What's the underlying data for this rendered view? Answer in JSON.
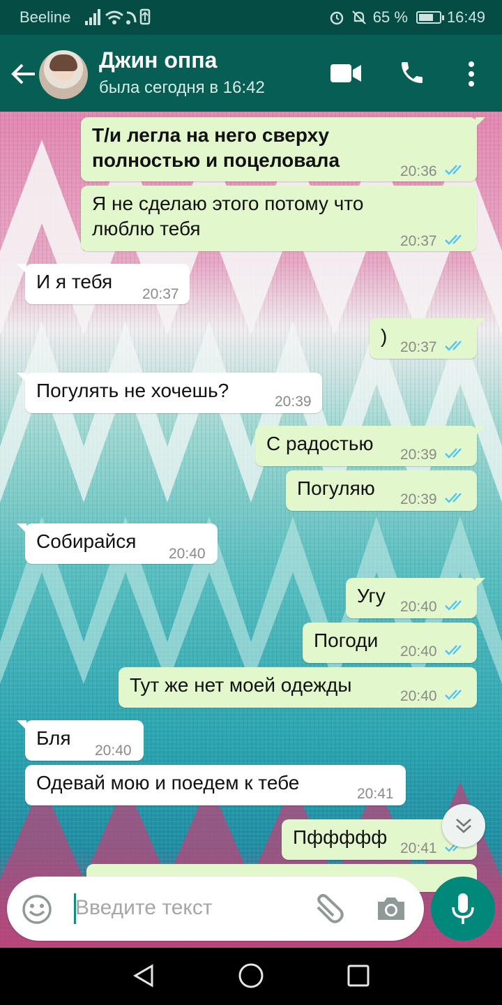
{
  "status_bar": {
    "carrier": "Beeline",
    "battery": "65 %",
    "time": "16:49"
  },
  "header": {
    "contact_name": "Джин оппа",
    "last_seen": "была сегодня в 16:42"
  },
  "messages": [
    {
      "text_line1": "Т/и легла на него сверху",
      "text_line2": "полностью и поцеловала",
      "time": "20:36",
      "direction": "out"
    },
    {
      "text_line1": "Я не сделаю этого потому что",
      "text_line2": "люблю тебя",
      "time": "20:37",
      "direction": "out"
    },
    {
      "text": "И я тебя",
      "time": "20:37",
      "direction": "in"
    },
    {
      "text": ")",
      "time": "20:37",
      "direction": "out"
    },
    {
      "text": "Погулять не хочешь?",
      "time": "20:39",
      "direction": "in"
    },
    {
      "text": "С радостью",
      "time": "20:39",
      "direction": "out"
    },
    {
      "text": "Погуляю",
      "time": "20:39",
      "direction": "out"
    },
    {
      "text": "Собирайся",
      "time": "20:40",
      "direction": "in"
    },
    {
      "text": "Угу",
      "time": "20:40",
      "direction": "out"
    },
    {
      "text": "Погоди",
      "time": "20:40",
      "direction": "out"
    },
    {
      "text": "Тут же нет моей одежды",
      "time": "20:40",
      "direction": "out"
    },
    {
      "text": "Бля",
      "time": "20:40",
      "direction": "in"
    },
    {
      "text": "Одевай мою и поедем к тебе",
      "time": "20:41",
      "direction": "in"
    },
    {
      "text": "Пффффф",
      "time": "20:41",
      "direction": "out"
    }
  ],
  "composer": {
    "placeholder": "Введите текст"
  },
  "colors": {
    "header": "#075e54",
    "status_bar": "#054d44",
    "outgoing_bubble": "#e2f7cb",
    "incoming_bubble": "#ffffff",
    "read_ticks": "#4fc3f7",
    "mic_button": "#00897b"
  },
  "icons": [
    "back-arrow-icon",
    "video-call-icon",
    "phone-icon",
    "more-vert-icon",
    "emoji-icon",
    "attach-icon",
    "camera-icon",
    "mic-icon",
    "scroll-down-icon",
    "nav-back-icon",
    "nav-home-icon",
    "nav-recents-icon"
  ]
}
